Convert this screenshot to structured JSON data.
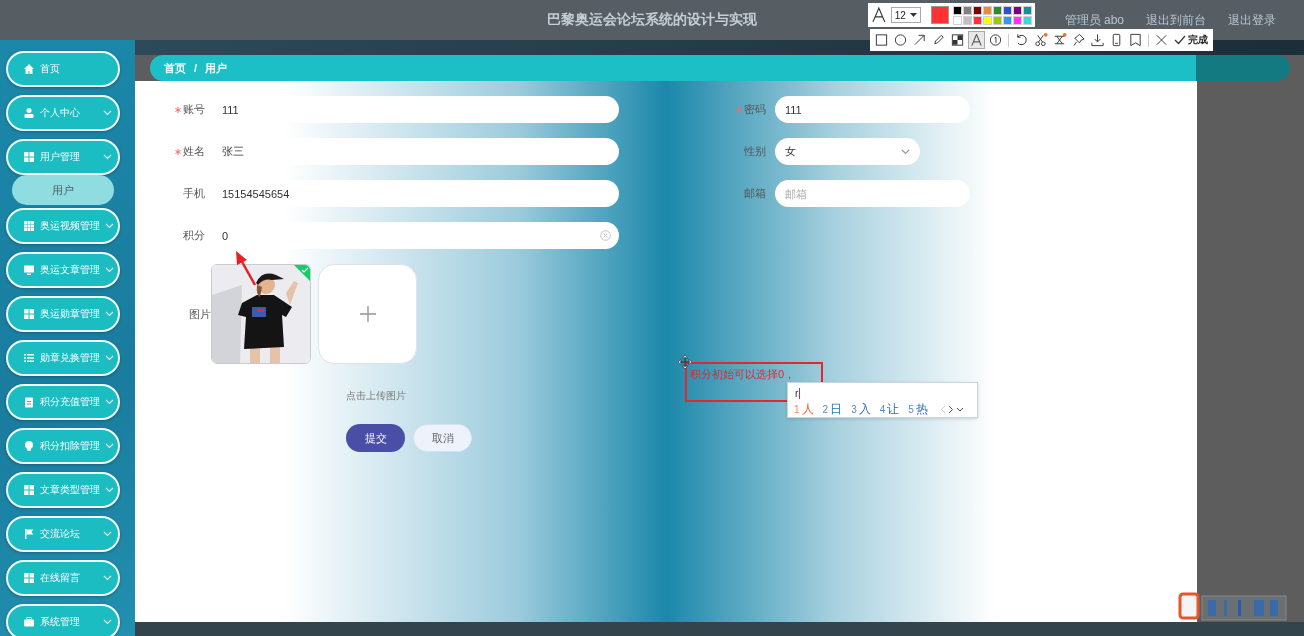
{
  "header": {
    "title": "巴黎奥运会论坛系统的设计与实现",
    "links": [
      "管理员 abo",
      "退出到前台",
      "退出登录"
    ]
  },
  "sidebar": {
    "items": [
      {
        "label": "首页",
        "kind": "link"
      },
      {
        "label": "个人中心",
        "kind": "menu"
      },
      {
        "label": "用户管理",
        "kind": "menu",
        "children": [
          {
            "label": "用户",
            "selected": true
          }
        ]
      },
      {
        "label": "奥运视频管理",
        "kind": "menu"
      },
      {
        "label": "奥运文章管理",
        "kind": "menu"
      },
      {
        "label": "奥运勋章管理",
        "kind": "menu"
      },
      {
        "label": "勋章兑换管理",
        "kind": "menu"
      },
      {
        "label": "积分充值管理",
        "kind": "menu"
      },
      {
        "label": "积分扣除管理",
        "kind": "menu"
      },
      {
        "label": "文章类型管理",
        "kind": "menu"
      },
      {
        "label": "交流论坛",
        "kind": "menu"
      },
      {
        "label": "在线留言",
        "kind": "menu"
      },
      {
        "label": "系统管理",
        "kind": "menu"
      }
    ]
  },
  "breadcrumb": {
    "items": [
      "首页",
      "用户"
    ],
    "separator": "/"
  },
  "form": {
    "rows": [
      {
        "fields": [
          {
            "label": "账号",
            "required": true,
            "kind": "input",
            "value": "111"
          },
          {
            "label": "密码",
            "required": true,
            "kind": "input",
            "value": "111"
          }
        ]
      },
      {
        "fields": [
          {
            "label": "姓名",
            "required": true,
            "kind": "input",
            "value": "张三"
          },
          {
            "label": "性别",
            "required": false,
            "kind": "select",
            "value": "女"
          }
        ]
      },
      {
        "fields": [
          {
            "label": "手机",
            "required": false,
            "kind": "input",
            "value": "15154545654"
          },
          {
            "label": "邮箱",
            "required": false,
            "kind": "input",
            "placeholder": "邮箱"
          }
        ]
      },
      {
        "fields": [
          {
            "label": "积分",
            "required": false,
            "kind": "clearable",
            "value": "0"
          }
        ]
      }
    ],
    "upload": {
      "label": "图片",
      "images": [
        {
          "kind": "picture",
          "uploaded": true
        }
      ],
      "hint": "点击上传图片"
    },
    "buttons": [
      {
        "label": "提交",
        "kind": "primary"
      },
      {
        "label": "取消",
        "kind": "plain"
      }
    ]
  },
  "capture_toolbar": {
    "font_size": "12",
    "current_swatch": {
      "color": "#ff3333"
    },
    "palette": [
      {
        "color": "#000000"
      },
      {
        "color": "#808080"
      },
      {
        "color": "#800000"
      },
      {
        "color": "#f08840"
      },
      {
        "color": "#2e8b2e"
      },
      {
        "color": "#3050d0"
      },
      {
        "color": "#800080"
      },
      {
        "color": "#009999"
      },
      {
        "color": "#ffffff"
      },
      {
        "color": "#c0c0c0"
      },
      {
        "color": "#ff3333"
      },
      {
        "color": "#ffff00"
      },
      {
        "color": "#99cc00"
      },
      {
        "color": "#3399ee"
      },
      {
        "color": "#ff33ff"
      },
      {
        "color": "#33dddd"
      }
    ],
    "tools": [
      {
        "kind": "rect",
        "selected": false
      },
      {
        "kind": "ellipse",
        "selected": false
      },
      {
        "kind": "arrow",
        "selected": false
      },
      {
        "kind": "pen",
        "selected": false
      },
      {
        "kind": "mosaic",
        "selected": false
      },
      {
        "kind": "text",
        "selected": true
      },
      {
        "kind": "serial",
        "selected": false
      },
      {
        "kind": "undo",
        "selected": false
      },
      {
        "kind": "scissors",
        "selected": false
      },
      {
        "kind": "crop",
        "selected": false
      },
      {
        "kind": "pin",
        "selected": false
      },
      {
        "kind": "download",
        "selected": false
      },
      {
        "kind": "device",
        "selected": false
      },
      {
        "kind": "bookmark",
        "selected": false
      },
      {
        "kind": "close",
        "selected": false
      }
    ],
    "done_label": "完成"
  },
  "annotation": {
    "text": "积分初始可以选择0，"
  },
  "ime": {
    "input": "r",
    "candidates": [
      {
        "number": "1",
        "text": "人",
        "selected": true
      },
      {
        "number": "2",
        "text": "日",
        "selected": false
      },
      {
        "number": "3",
        "text": "入",
        "selected": false
      },
      {
        "number": "4",
        "text": "让",
        "selected": false
      },
      {
        "number": "5",
        "text": "热",
        "selected": false
      }
    ]
  }
}
